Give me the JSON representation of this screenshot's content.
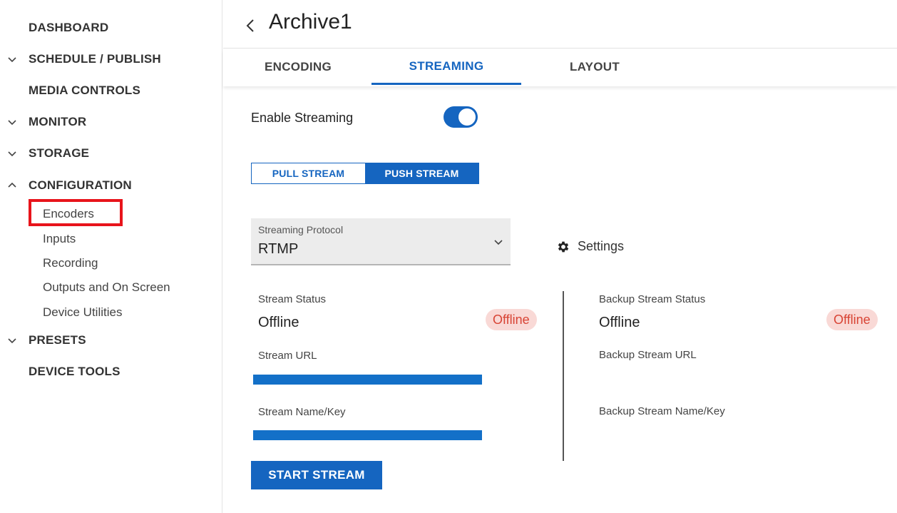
{
  "sidebar": {
    "items": [
      {
        "label": "DASHBOARD"
      },
      {
        "label": "SCHEDULE / PUBLISH"
      },
      {
        "label": "MEDIA CONTROLS"
      },
      {
        "label": "MONITOR"
      },
      {
        "label": "STORAGE"
      },
      {
        "label": "CONFIGURATION"
      },
      {
        "label": "PRESETS"
      },
      {
        "label": "DEVICE TOOLS"
      }
    ],
    "configuration_children": [
      {
        "label": "Encoders",
        "selected": true
      },
      {
        "label": "Inputs"
      },
      {
        "label": "Recording"
      },
      {
        "label": "Outputs and On Screen"
      },
      {
        "label": "Device Utilities"
      }
    ]
  },
  "header": {
    "title": "Archive1"
  },
  "tabs": [
    {
      "label": "ENCODING"
    },
    {
      "label": "STREAMING",
      "active": true
    },
    {
      "label": "LAYOUT"
    }
  ],
  "streaming": {
    "enable_label": "Enable Streaming",
    "enabled": true,
    "mode_options": [
      {
        "label": "PULL STREAM",
        "selected": false
      },
      {
        "label": "PUSH STREAM",
        "selected": true
      }
    ],
    "protocol": {
      "label": "Streaming Protocol",
      "value": "RTMP"
    },
    "settings_label": "Settings",
    "primary": {
      "status_label": "Stream Status",
      "status_value": "Offline",
      "status_badge": "Offline",
      "url_label": "Stream URL",
      "key_label": "Stream Name/Key"
    },
    "backup": {
      "status_label": "Backup Stream Status",
      "status_value": "Offline",
      "status_badge": "Offline",
      "url_label": "Backup Stream URL",
      "key_label": "Backup Stream Name/Key"
    },
    "start_button": "START STREAM"
  },
  "colors": {
    "accent": "#1565c0",
    "highlight_box": "#e8141b",
    "badge_bg": "#f9d9d6",
    "badge_text": "#d84334"
  }
}
